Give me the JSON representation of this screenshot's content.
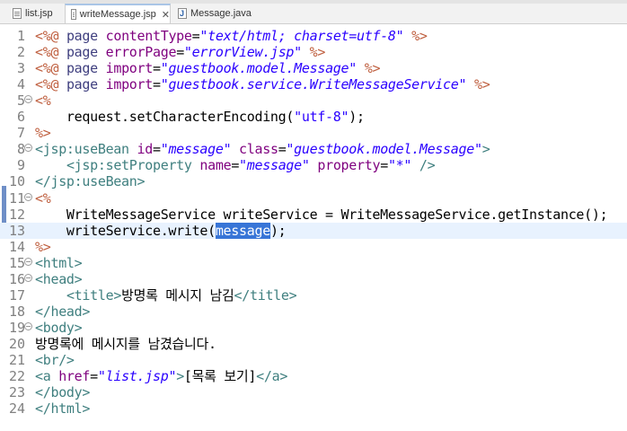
{
  "tabs": [
    {
      "label": "list.jsp",
      "icon": "jsp-file-icon",
      "active": false
    },
    {
      "label": "writeMessage.jsp",
      "icon": "jsp-file-icon",
      "active": true,
      "close": "✕"
    },
    {
      "label": "Message.java",
      "icon": "java-file-icon",
      "active": false
    }
  ],
  "colors": {
    "delimiter": "#bf5f3f",
    "tag": "#3f7f7f",
    "attribute": "#7f007f",
    "string": "#2a00ff",
    "selection": "#3875d7"
  },
  "editor": {
    "current_line": 13,
    "lines": [
      {
        "num": "1",
        "tokens": [
          [
            "delim",
            "<%@"
          ],
          [
            "plain",
            " "
          ],
          [
            "kw",
            "page"
          ],
          [
            "plain",
            " "
          ],
          [
            "attr",
            "contentType"
          ],
          [
            "plain",
            "="
          ],
          [
            "str",
            "\"text/html; charset=utf-8\""
          ],
          [
            "plain",
            " "
          ],
          [
            "delim",
            "%>"
          ]
        ]
      },
      {
        "num": "2",
        "tokens": [
          [
            "delim",
            "<%@"
          ],
          [
            "plain",
            " "
          ],
          [
            "kw",
            "page"
          ],
          [
            "plain",
            " "
          ],
          [
            "attr",
            "errorPage"
          ],
          [
            "plain",
            "="
          ],
          [
            "str",
            "\"errorView.jsp\""
          ],
          [
            "plain",
            " "
          ],
          [
            "delim",
            "%>"
          ]
        ]
      },
      {
        "num": "3",
        "tokens": [
          [
            "delim",
            "<%@"
          ],
          [
            "plain",
            " "
          ],
          [
            "kw",
            "page"
          ],
          [
            "plain",
            " "
          ],
          [
            "attr",
            "import"
          ],
          [
            "plain",
            "="
          ],
          [
            "str",
            "\"guestbook.model.Message\""
          ],
          [
            "plain",
            " "
          ],
          [
            "delim",
            "%>"
          ]
        ]
      },
      {
        "num": "4",
        "tokens": [
          [
            "delim",
            "<%@"
          ],
          [
            "plain",
            " "
          ],
          [
            "kw",
            "page"
          ],
          [
            "plain",
            " "
          ],
          [
            "attr",
            "import"
          ],
          [
            "plain",
            "="
          ],
          [
            "str",
            "\"guestbook.service.WriteMessageService\""
          ],
          [
            "plain",
            " "
          ],
          [
            "delim",
            "%>"
          ]
        ]
      },
      {
        "num": "5",
        "fold": true,
        "tokens": [
          [
            "delim",
            "<%"
          ]
        ]
      },
      {
        "num": "6",
        "tokens": [
          [
            "java",
            "    request.setCharacterEncoding("
          ],
          [
            "jstr",
            "\"utf-8\""
          ],
          [
            "java",
            ");"
          ]
        ]
      },
      {
        "num": "7",
        "tokens": [
          [
            "delim",
            "%>"
          ]
        ]
      },
      {
        "num": "8",
        "fold": true,
        "tokens": [
          [
            "tag",
            "<jsp:useBean"
          ],
          [
            "plain",
            " "
          ],
          [
            "attr",
            "id"
          ],
          [
            "plain",
            "="
          ],
          [
            "str",
            "\"message\""
          ],
          [
            "plain",
            " "
          ],
          [
            "attr",
            "class"
          ],
          [
            "plain",
            "="
          ],
          [
            "str",
            "\"guestbook.model.Message\""
          ],
          [
            "tag",
            ">"
          ]
        ]
      },
      {
        "num": "9",
        "tokens": [
          [
            "plain",
            "    "
          ],
          [
            "tag",
            "<jsp:setProperty"
          ],
          [
            "plain",
            " "
          ],
          [
            "attr",
            "name"
          ],
          [
            "plain",
            "="
          ],
          [
            "str",
            "\"message\""
          ],
          [
            "plain",
            " "
          ],
          [
            "attr",
            "property"
          ],
          [
            "plain",
            "="
          ],
          [
            "str",
            "\"*\""
          ],
          [
            "plain",
            " "
          ],
          [
            "tag",
            "/>"
          ]
        ]
      },
      {
        "num": "10",
        "tokens": [
          [
            "tag",
            "</jsp:useBean>"
          ]
        ]
      },
      {
        "num": "11",
        "fold": true,
        "tokens": [
          [
            "delim",
            "<%"
          ]
        ]
      },
      {
        "num": "12",
        "tokens": [
          [
            "java",
            "    WriteMessageService writeService = WriteMessageService.getInstance();"
          ]
        ]
      },
      {
        "num": "13",
        "tokens": [
          [
            "java",
            "    writeService.write("
          ],
          [
            "sel",
            "message"
          ],
          [
            "java",
            ");"
          ]
        ]
      },
      {
        "num": "14",
        "tokens": [
          [
            "delim",
            "%>"
          ]
        ]
      },
      {
        "num": "15",
        "fold": true,
        "tokens": [
          [
            "tag",
            "<html>"
          ]
        ]
      },
      {
        "num": "16",
        "fold": true,
        "tokens": [
          [
            "tag",
            "<head>"
          ]
        ]
      },
      {
        "num": "17",
        "tokens": [
          [
            "plain",
            "    "
          ],
          [
            "tag",
            "<title>"
          ],
          [
            "plain",
            "방명록 메시지 남김"
          ],
          [
            "tag",
            "</title>"
          ]
        ]
      },
      {
        "num": "18",
        "tokens": [
          [
            "tag",
            "</head>"
          ]
        ]
      },
      {
        "num": "19",
        "fold": true,
        "tokens": [
          [
            "tag",
            "<body>"
          ]
        ]
      },
      {
        "num": "20",
        "tokens": [
          [
            "plain",
            "방명록에 메시지를 남겼습니다."
          ]
        ]
      },
      {
        "num": "21",
        "tokens": [
          [
            "tag",
            "<br/>"
          ]
        ]
      },
      {
        "num": "22",
        "tokens": [
          [
            "tag",
            "<a"
          ],
          [
            "plain",
            " "
          ],
          [
            "attr",
            "href"
          ],
          [
            "plain",
            "="
          ],
          [
            "str",
            "\"list.jsp\""
          ],
          [
            "tag",
            ">"
          ],
          [
            "plain",
            "[목록 보기]"
          ],
          [
            "tag",
            "</a>"
          ]
        ]
      },
      {
        "num": "23",
        "tokens": [
          [
            "tag",
            "</body>"
          ]
        ]
      },
      {
        "num": "24",
        "tokens": [
          [
            "tag",
            "</html>"
          ]
        ]
      }
    ]
  }
}
